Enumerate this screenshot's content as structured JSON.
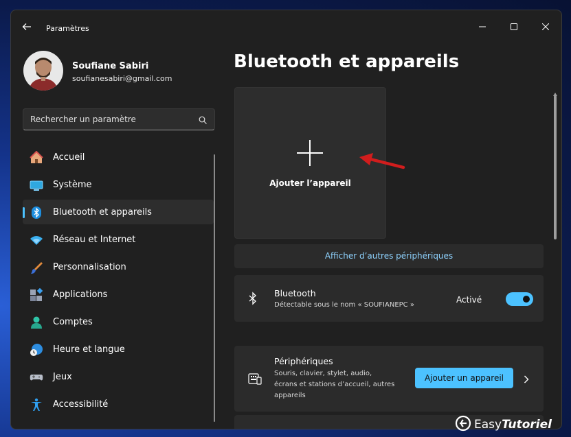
{
  "window": {
    "title": "Paramètres"
  },
  "user": {
    "name": "Soufiane Sabiri",
    "email": "soufianesabiri@gmail.com"
  },
  "search": {
    "placeholder": "Rechercher un paramètre"
  },
  "sidebar": {
    "items": [
      {
        "label": "Accueil",
        "icon": "home-icon"
      },
      {
        "label": "Système",
        "icon": "system-icon"
      },
      {
        "label": "Bluetooth et appareils",
        "icon": "bluetooth-icon",
        "active": true
      },
      {
        "label": "Réseau et Internet",
        "icon": "wifi-icon"
      },
      {
        "label": "Personnalisation",
        "icon": "brush-icon"
      },
      {
        "label": "Applications",
        "icon": "apps-icon"
      },
      {
        "label": "Comptes",
        "icon": "person-icon"
      },
      {
        "label": "Heure et langue",
        "icon": "clock-globe-icon"
      },
      {
        "label": "Jeux",
        "icon": "gamepad-icon"
      },
      {
        "label": "Accessibilité",
        "icon": "accessibility-icon"
      }
    ]
  },
  "main": {
    "title": "Bluetooth et appareils",
    "add_tile_label": "Ajouter l’appareil",
    "show_more": "Afficher d’autres périphériques",
    "bluetooth": {
      "title": "Bluetooth",
      "subtitle": "Détectable sous le nom « SOUFIANEPC »",
      "status": "Activé",
      "enabled": true
    },
    "peripherals": {
      "title": "Périphériques",
      "description_lines": [
        "Souris, clavier, stylet, audio,",
        "écrans et stations d’accueil, autres",
        "appareils"
      ],
      "button": "Ajouter un appareil"
    }
  },
  "watermark": {
    "prefix": "Easy",
    "suffix": "Tutoriel"
  },
  "colors": {
    "accent": "#4cc2ff",
    "window_bg": "#202020",
    "card_bg": "#2b2b2b",
    "arrow": "#d11d1d"
  }
}
